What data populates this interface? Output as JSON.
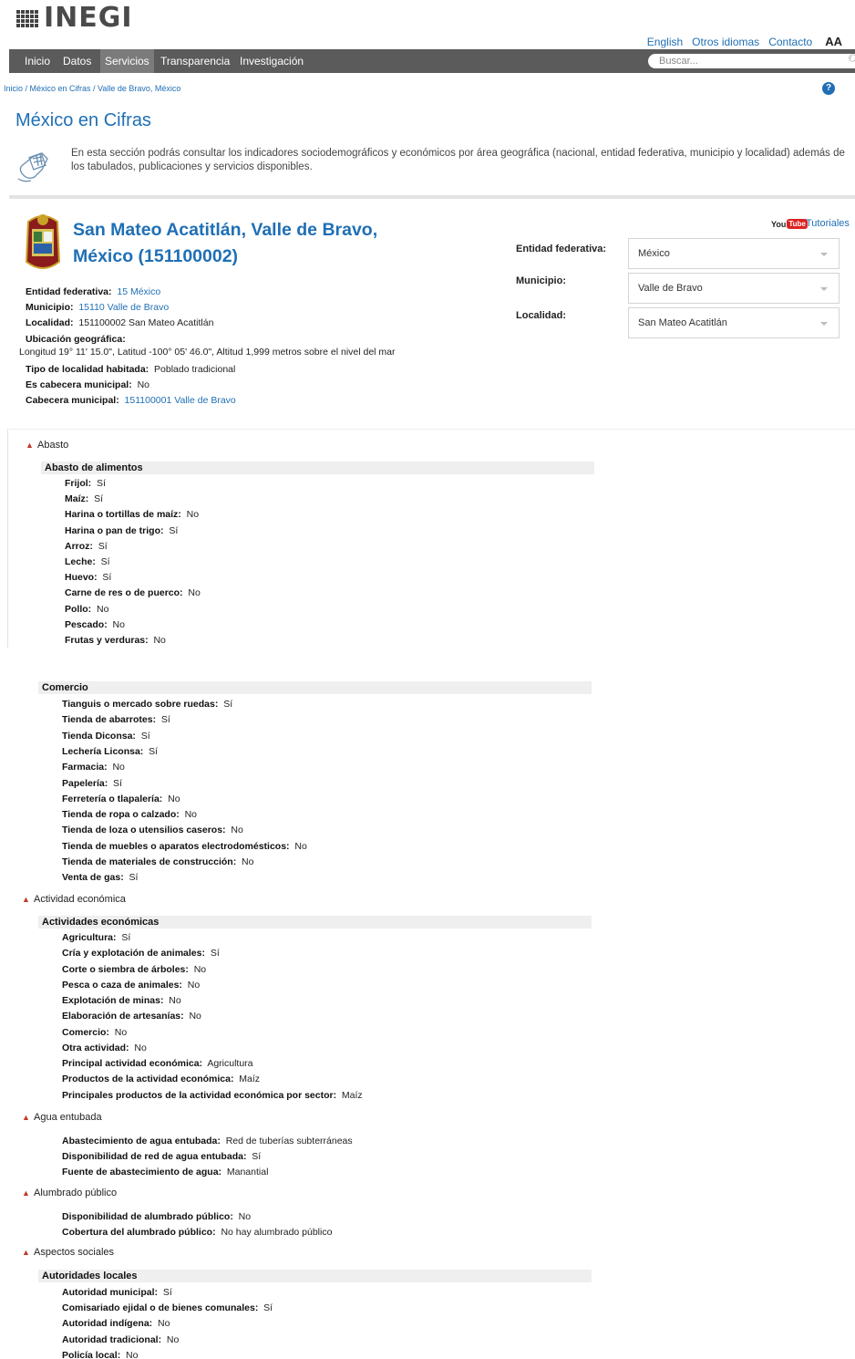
{
  "header": {
    "logo_text": "INEGI",
    "links": [
      "English",
      "Otros idiomas",
      "Contacto"
    ],
    "font_size_label": "AA",
    "nav": [
      "Inicio",
      "Datos",
      "Servicios",
      "Transparencia",
      "Investigación"
    ],
    "active_nav": "Servicios",
    "search_placeholder": "Buscar..."
  },
  "breadcrumb": "Inicio / México en Cifras / Valle de Bravo, México",
  "help_label": "?",
  "page": {
    "title": "México en Cifras",
    "intro": "En esta sección podrás consultar los indicadores sociodemográficos y económicos por área geográfica (nacional, entidad federativa, municipio y localidad) además de los tabulados, publicaciones y servicios disponibles."
  },
  "place": {
    "title_line1": "San Mateo Acatitlán, Valle de Bravo,",
    "title_line2": "México (151100002)",
    "fields": [
      {
        "label": "Entidad federativa:",
        "value": "15 México",
        "link": true
      },
      {
        "label": "Municipio:",
        "value": "15110 Valle de Bravo",
        "link": true
      },
      {
        "label": "Localidad:",
        "value": "151100002 San Mateo Acatitlán",
        "link": false
      },
      {
        "label": "Ubicación geográfica:",
        "value": "",
        "link": false
      }
    ],
    "coordinates": "Longitud 19° 11' 15.0\", Latitud -100° 05' 46.0\", Altitud 1,999 metros sobre el nivel del mar",
    "fields2": [
      {
        "label": "Tipo de localidad habitada:",
        "value": "Poblado tradicional",
        "link": false
      },
      {
        "label": "Es cabecera municipal:",
        "value": "No",
        "link": false
      },
      {
        "label": "Cabecera municipal:",
        "value": "151100001 Valle de Bravo",
        "link": true
      }
    ]
  },
  "tutorials": {
    "you": "You",
    "tube": "Tube",
    "label": "Tutoriales"
  },
  "selectors": [
    {
      "label": "Entidad federativa:",
      "value": "México"
    },
    {
      "label": "Municipio:",
      "value": "Valle de Bravo"
    },
    {
      "label": "Localidad:",
      "value": "San Mateo Acatitlán"
    }
  ],
  "sections": {
    "abasto": "Abasto",
    "abasto_alimentos": "Abasto de alimentos",
    "alimentos": [
      {
        "label": "Frijol:",
        "value": "Sí"
      },
      {
        "label": "Maíz:",
        "value": "Sí"
      },
      {
        "label": "Harina o tortillas de maíz:",
        "value": "No"
      },
      {
        "label": "Harina o pan de trigo:",
        "value": "Sí"
      },
      {
        "label": "Arroz:",
        "value": "Sí"
      },
      {
        "label": "Leche:",
        "value": "Sí"
      },
      {
        "label": "Huevo:",
        "value": "Sí"
      },
      {
        "label": "Carne de res o de puerco:",
        "value": "No"
      },
      {
        "label": "Pollo:",
        "value": "No"
      },
      {
        "label": "Pescado:",
        "value": "No"
      },
      {
        "label": "Frutas y verduras:",
        "value": "No"
      }
    ],
    "comercio": "Comercio",
    "comercio_items": [
      {
        "label": "Tianguis o mercado sobre ruedas:",
        "value": "Sí"
      },
      {
        "label": "Tienda de abarrotes:",
        "value": "Sí"
      },
      {
        "label": "Tienda Diconsa:",
        "value": "Sí"
      },
      {
        "label": "Lechería Liconsa:",
        "value": "Sí"
      },
      {
        "label": "Farmacia:",
        "value": "No"
      },
      {
        "label": "Papelería:",
        "value": "Sí"
      },
      {
        "label": "Ferretería o tlapalería:",
        "value": "No"
      },
      {
        "label": "Tienda de ropa o calzado:",
        "value": "No"
      },
      {
        "label": "Tienda de loza o utensilios caseros:",
        "value": "No"
      },
      {
        "label": "Tienda de muebles o aparatos electrodomésticos:",
        "value": "No"
      },
      {
        "label": "Tienda de materiales de construcción:",
        "value": "No"
      },
      {
        "label": "Venta de gas:",
        "value": "Sí"
      }
    ],
    "actividad": "Actividad económica",
    "actividades_head": "Actividades económicas",
    "actividades": [
      {
        "label": "Agricultura:",
        "value": "Sí"
      },
      {
        "label": "Cría y explotación de animales:",
        "value": "Sí"
      },
      {
        "label": "Corte o siembra de árboles:",
        "value": "No"
      },
      {
        "label": "Pesca o caza de animales:",
        "value": "No"
      },
      {
        "label": "Explotación de minas:",
        "value": "No"
      },
      {
        "label": "Elaboración de artesanías:",
        "value": "No"
      },
      {
        "label": "Comercio:",
        "value": "No"
      },
      {
        "label": "Otra actividad:",
        "value": "No"
      },
      {
        "label": "Principal actividad económica:",
        "value": "Agricultura"
      },
      {
        "label": "Productos de la actividad económica:",
        "value": "Maíz"
      },
      {
        "label": "Principales productos de la actividad económica por sector:",
        "value": "Maíz"
      }
    ],
    "agua": "Agua entubada",
    "agua_items": [
      {
        "label": "Abastecimiento de agua entubada:",
        "value": "Red de tuberías subterráneas"
      },
      {
        "label": "Disponibilidad de red de agua entubada:",
        "value": "Sí"
      },
      {
        "label": "Fuente de abastecimiento de agua:",
        "value": "Manantial"
      }
    ],
    "alumbrado": "Alumbrado público",
    "alumbrado_items": [
      {
        "label": "Disponibilidad de alumbrado público:",
        "value": "No"
      },
      {
        "label": "Cobertura del alumbrado público:",
        "value": "No hay alumbrado público"
      }
    ],
    "aspectos": "Aspectos sociales",
    "autoridades_head": "Autoridades locales",
    "autoridades": [
      {
        "label": "Autoridad municipal:",
        "value": "Sí"
      },
      {
        "label": "Comisariado ejidal o de bienes comunales:",
        "value": "Sí"
      },
      {
        "label": "Autoridad indígena:",
        "value": "No"
      },
      {
        "label": "Autoridad tradicional:",
        "value": "No"
      },
      {
        "label": "Policía local:",
        "value": "No"
      }
    ]
  },
  "colors": {
    "link": "#1f6fb5",
    "nav_bg": "#5b5b5b",
    "chevron": "#c0392b"
  }
}
